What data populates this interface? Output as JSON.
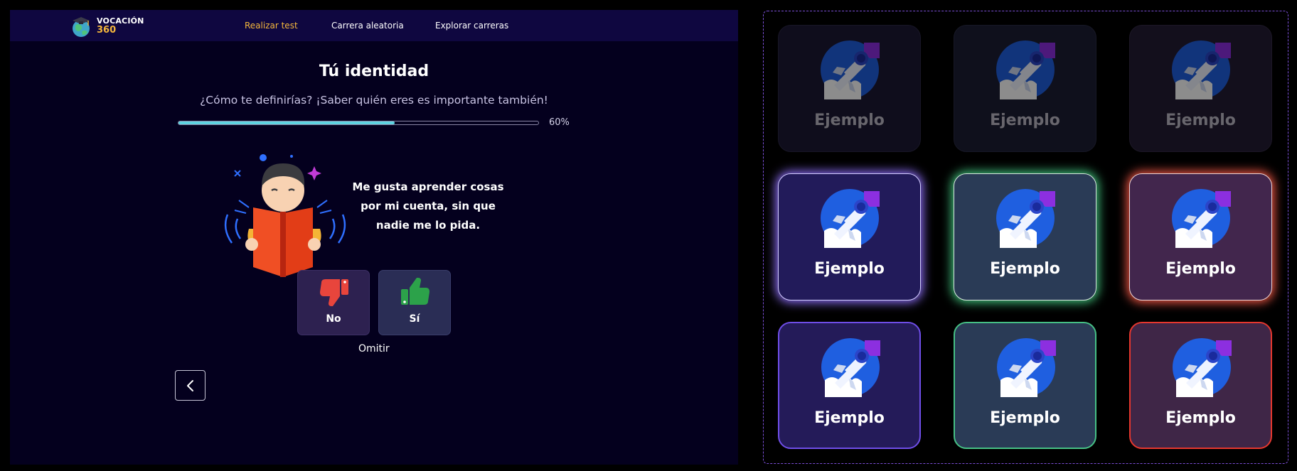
{
  "nav": {
    "brand_line1": "VOCACIÓN",
    "brand_line2": "360",
    "links": [
      {
        "label": "Realizar test",
        "active": true
      },
      {
        "label": "Carrera aleatoria",
        "active": false
      },
      {
        "label": "Explorar carreras",
        "active": false
      }
    ]
  },
  "test": {
    "title": "Tú identidad",
    "subtitle": "¿Cómo te definirías? ¡Saber quién eres es importante también!",
    "progress_percent": 60,
    "progress_label": "60%",
    "statement": "Me gusta aprender cosas por mi cuenta, sin que nadie me lo pida.",
    "answers": {
      "no_label": "No",
      "yes_label": "Sí"
    },
    "skip_label": "Omitir"
  },
  "gallery": {
    "cards": [
      {
        "label": "Ejemplo",
        "state": "default"
      },
      {
        "label": "Ejemplo",
        "state": "default"
      },
      {
        "label": "Ejemplo",
        "state": "default"
      },
      {
        "label": "Ejemplo",
        "state": "hover-glow"
      },
      {
        "label": "Ejemplo",
        "state": "hover-glow"
      },
      {
        "label": "Ejemplo",
        "state": "hover-glow"
      },
      {
        "label": "Ejemplo",
        "state": "selected"
      },
      {
        "label": "Ejemplo",
        "state": "selected"
      },
      {
        "label": "Ejemplo",
        "state": "selected"
      }
    ]
  },
  "colors": {
    "accent": "#f5b73c",
    "progress": "#5fd3e1",
    "purple": "#6f4ee8",
    "green": "#46c085",
    "red": "#e6372e"
  },
  "icons": [
    "globe-graduation-logo",
    "thumbs-down-icon",
    "thumbs-up-icon",
    "chevron-left-icon",
    "rocket-icon",
    "reading-boy-illustration"
  ]
}
